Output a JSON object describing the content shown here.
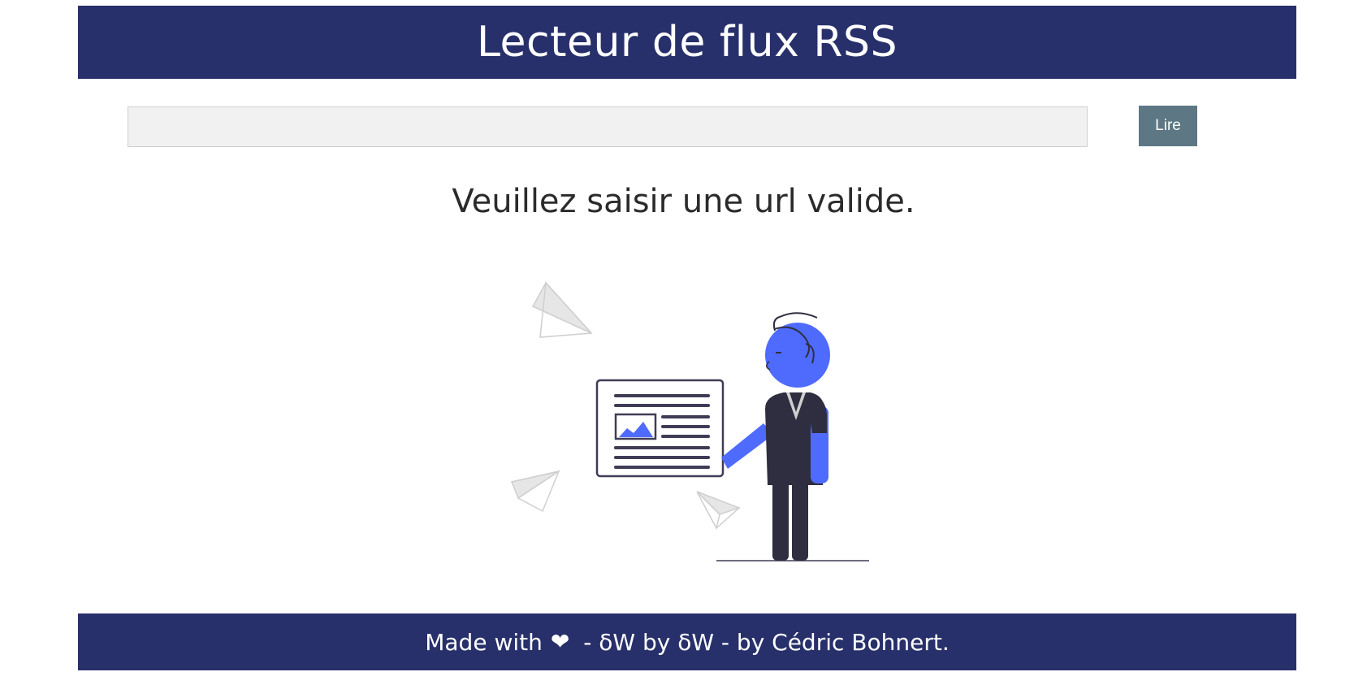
{
  "header": {
    "title": "Lecteur de flux RSS"
  },
  "search": {
    "value": "",
    "placeholder": "",
    "button_label": "Lire"
  },
  "main": {
    "message": "Veuillez saisir une url valide."
  },
  "footer": {
    "made_with": "Made with",
    "heart_icon": "heart-icon",
    "rest": " - δW by δW - by Cédric Bohnert."
  },
  "colors": {
    "header_bg": "#27306a",
    "button_bg": "#5d7785",
    "accent_blue": "#4f6bfe",
    "dark": "#2f2e41"
  }
}
